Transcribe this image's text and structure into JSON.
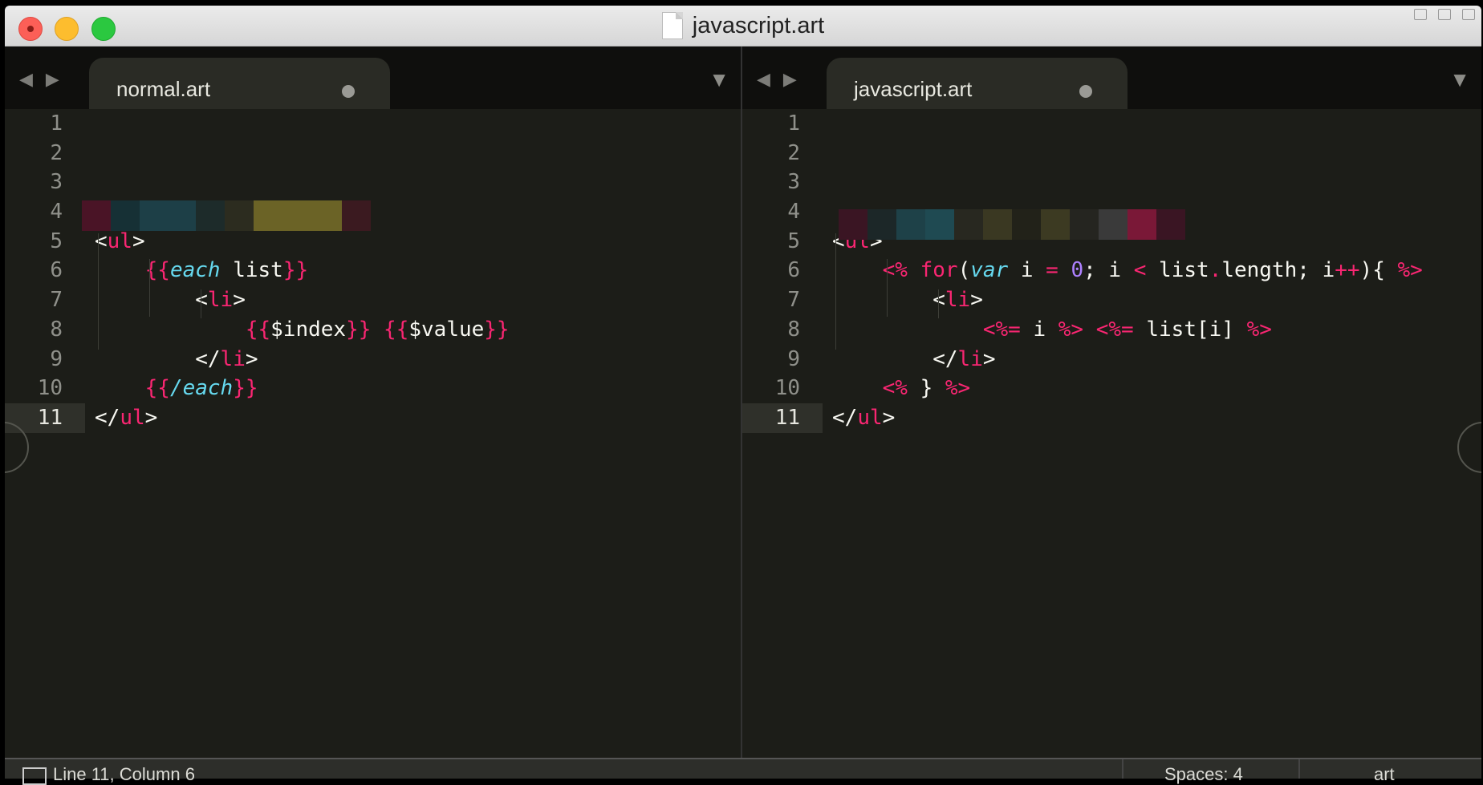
{
  "window": {
    "title": "javascript.art"
  },
  "left_pane": {
    "tab_label": "normal.art",
    "lines": [
      {
        "n": "1",
        "html": ""
      },
      {
        "n": "2",
        "html": ""
      },
      {
        "n": "3",
        "html": ""
      },
      {
        "n": "4",
        "html": ""
      },
      {
        "n": "5",
        "html": "&lt;<span class='pink'>ul</span>&gt;"
      },
      {
        "n": "6",
        "html": "    <span class='pink'>{{</span><span class='teal'>each</span> list<span class='pink'>}}</span>"
      },
      {
        "n": "7",
        "html": "        &lt;<span class='pink'>li</span>&gt;"
      },
      {
        "n": "8",
        "html": "            <span class='pink'>{{</span>$index<span class='pink'>}}</span> <span class='pink'>{{</span>$value<span class='pink'>}}</span>"
      },
      {
        "n": "9",
        "html": "        &lt;/<span class='pink'>li</span>&gt;"
      },
      {
        "n": "10",
        "html": "    <span class='pink'>{{</span><span class='teal'>/each</span><span class='pink'>}}</span>"
      },
      {
        "n": "11",
        "html": "&lt;/<span class='pink'>ul</span>&gt;"
      }
    ],
    "current_line": "11"
  },
  "right_pane": {
    "tab_label": "javascript.art",
    "lines": [
      {
        "n": "1",
        "html": ""
      },
      {
        "n": "2",
        "html": ""
      },
      {
        "n": "3",
        "html": ""
      },
      {
        "n": "4",
        "html": ""
      },
      {
        "n": "5",
        "html": "&lt;<span class='pink'>ul</span>&gt;"
      },
      {
        "n": "6",
        "html": "    <span class='pink'>&lt;%</span> <span class='pink'>for</span>(<span class='teal'>var</span> i <span class='pink'>=</span> <span class='purple'>0</span>; i <span class='pink'>&lt;</span> list<span class='pink'>.</span>length; i<span class='pink'>++</span>){ <span class='pink'>%&gt;</span>"
      },
      {
        "n": "7",
        "html": "        &lt;<span class='pink'>li</span>&gt;"
      },
      {
        "n": "8",
        "html": "            <span class='pink'>&lt;%=</span> i <span class='pink'>%&gt;</span> <span class='pink'>&lt;%=</span> list[i] <span class='pink'>%&gt;</span>"
      },
      {
        "n": "9",
        "html": "        &lt;/<span class='pink'>li</span>&gt;"
      },
      {
        "n": "10",
        "html": "    <span class='pink'>&lt;%</span> } <span class='pink'>%&gt;</span>"
      },
      {
        "n": "11",
        "html": "&lt;/<span class='pink'>ul</span>&gt;"
      }
    ],
    "current_line": "11"
  },
  "status": {
    "position": "Line 11, Column 6",
    "spaces": "Spaces: 4",
    "syntax": "art"
  },
  "colors": {
    "editor_bg": "#1c1d18",
    "keyword": "#f92672",
    "type": "#66d9ef",
    "number": "#ae81ff"
  }
}
